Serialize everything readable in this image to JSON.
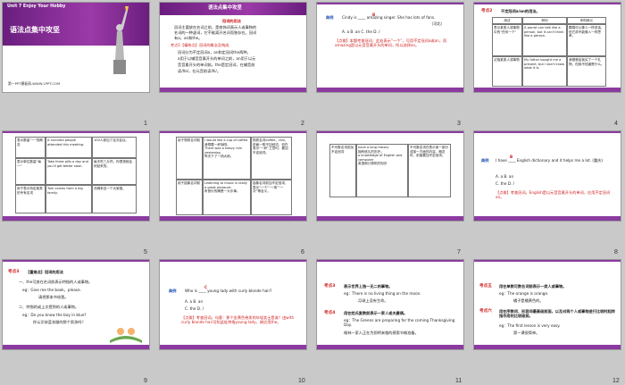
{
  "slides": [
    {
      "num": "1",
      "unit": "Unit 7    Enjoy Your Hobby",
      "title": "语法点集中攻坚",
      "footer": "第一PPT模板网-WWW.1PPT.COM"
    },
    {
      "num": "2",
      "header": "语法点集中攻坚",
      "sub": "冠词的用法",
      "l1": "冠词主要放在名词之前，是修饰词表示人或事物的",
      "l2": "名词的一种虚词，它不能离开名词而独存在。冠词",
      "l3": "有a，an和the。",
      "l4": "考点1【精练点】冠词的概念及构成",
      "l5": "冠词分为不定冠词a，an和定冠词the两种。",
      "l6": "a用于以辅音音素开头的单词之前，an用于以元",
      "l7": "音音素开头的单词前。the是定冠词，在辅音前",
      "l8": "读/ðə/，在元音前读/ði/。"
    },
    {
      "num": "3",
      "label": "典例",
      "q": "Cindy is ____ amazing singer. She has lots of fans.",
      "ans": "B",
      "src": "（河北）",
      "opts": "A. a      B. an      C. the      D. /",
      "note": "【点拨】本题考查冠词，此处表示“一个”，可用不定冠词a或an，而amazing是以元音音素开头的单词，所以选择an。"
    },
    {
      "num": "4",
      "tag": "考点2",
      "tagtext": "不定冠词a/an的用法。",
      "h1": "用法",
      "h2": "例句",
      "h3": "例句释义",
      "r1a": "表示某类人或事物中的“任何一个”",
      "r1b": "A parrot can talk like a person, but it can't think like a person.",
      "r1c": "鹦鹉可以像人一样说话，但它却不能像人一样思考。",
      "r2a": "泛指某类人或事物",
      "r2b": "My father bought me a present, but I don't know what it is.",
      "r2c": "我爸爸给我买了一个礼物，但我不知道是什么。"
    },
    {
      "num": "5",
      "r1a": "表示数量“一”的概念",
      "r1b": "A hundred people attended this meeting.",
      "r1c": "100人参加了这次会议。",
      "r2a": "表示单位数量“每一”",
      "r2b": "Take three pills a day and you'll get better soon.",
      "r2c": "每天吃三片药，你很快就会好起来的。",
      "r3a": "用于表示特定某类的专有名词",
      "r3b": "Tom comes from a big family.",
      "r3c": "汤姆来自一个大家庭。"
    },
    {
      "num": "6",
      "r1a": "用于物质名词前",
      "r1b": "I would like a cup of coffee.\n我想要一杯咖啡。\nThere was a heavy rain yesterday.\n昨天下了一场大雨。",
      "r1c": "物质名词coffee，rain，前面一般不加冠词，但在表示“一杯”之意时，要加不定冠词。",
      "r2a": "用于抽象名词前",
      "r2b": "Listening to music is really a great pleasure.\n听音乐的确是一大乐事。",
      "r2c": "抽象名词前加不定冠词，表示“一个”“一场”“一次”等含义。"
    },
    {
      "num": "7",
      "r1a": "不可数名词前加不定冠词",
      "r1b": "have a long history\n拥有悠久的历史；\na knowledge of English and computer\n英语和计算机的知识",
      "r1c": "不可数名词在表示某一部分或某一方面的内容，概念时，前面要加不定冠词。"
    },
    {
      "num": "8",
      "label": "典例",
      "q1": "I have ____ English dictionary and it helps me a lot. (重庆)",
      "ans": "B",
      "opts1": "A. a        B. an",
      "opts2": "C. the      D. /",
      "note": "【点拨】考查冠词。English是以元音音素开头的单词，应用不定冠词an。"
    },
    {
      "num": "9",
      "tag": "考点3",
      "tagtext": "【重难点】冠词的用法",
      "l1": "一、the可放在名词前表示特指的人或事物。",
      "l2": "eg：Give me the book，please.",
      "l3": "请把那本书给我。",
      "l4": "二、特指的或上文提到的人或事物。",
      "l5": "eg：Do you know the boy in blue?",
      "l6": "你认识穿蓝衣服的那个男孩吗？"
    },
    {
      "num": "10",
      "label": "典例",
      "q": "Who is ____ young lady with curly blonde hair?",
      "ans": "C",
      "opts1": "A. a          B. an",
      "opts2": "C. the        D. /",
      "note": "【点拨】考查冠词。句意：那个金黄色卷发的年轻女士是谁？由with curly blonde hair可知此处特指young lady，故应用the。"
    },
    {
      "num": "11",
      "tag1": "考点3",
      "l1": "表示世界上独一无二的事物。",
      "l2": "eg：There is no living thing on the moon.",
      "l3": "月球上没有生命。",
      "tag2": "考点4",
      "l4": "用在姓氏复数前表示一家人或夫妻俩。",
      "l5": "eg：The Greens are preparing for the coming Thanksgiving Day.",
      "l6": "格林一家人正在为即将来临的感恩节做准备。"
    },
    {
      "num": "12",
      "tag1": "考点五",
      "l1": "用在单数可数名词前表示一类人或事物。",
      "l2": "eg：The orange is orange.",
      "l3": "橘子是橘黄色的。",
      "tag2": "考点六",
      "l4": "用在序数词、形容词最高级前面，以及对两个人或事物进行比较时起特指作用的比较级前。",
      "l5": "eg：The first lesson is very easy.",
      "l6": "第一课很简单。"
    }
  ]
}
